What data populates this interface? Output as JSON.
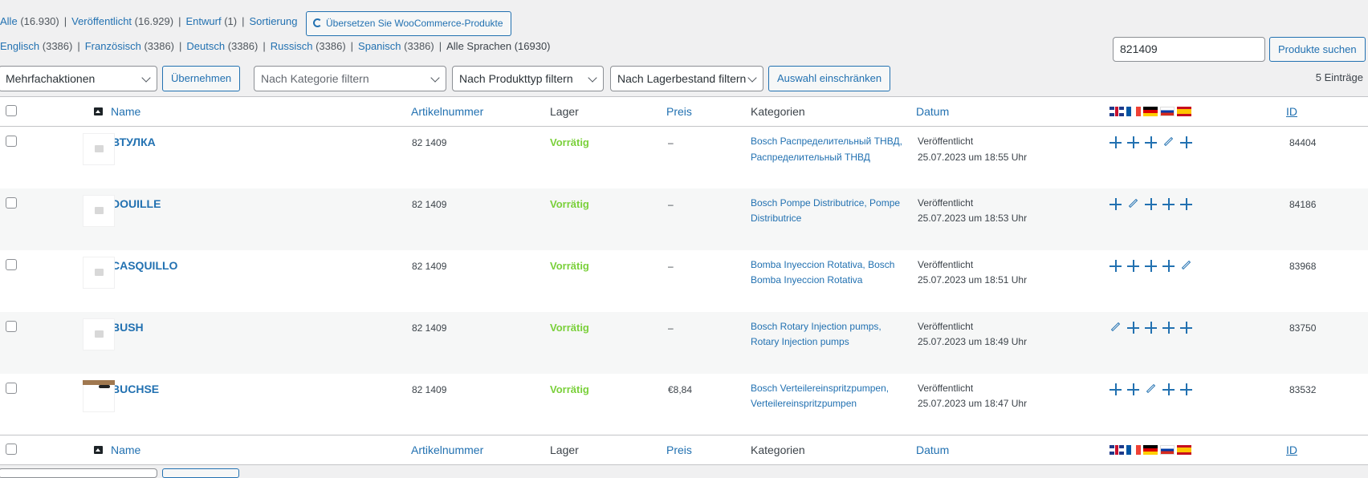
{
  "views": [
    {
      "label": "Alle",
      "count": "(16.930)"
    },
    {
      "label": "Veröffentlicht",
      "count": "(16.929)"
    },
    {
      "label": "Entwurf",
      "count": "(1)"
    },
    {
      "label": "Sortierung",
      "count": ""
    }
  ],
  "wpml_button": "Übersetzen Sie WooCommerce-Produkte",
  "languages": [
    {
      "label": "Englisch",
      "count": "(3386)"
    },
    {
      "label": "Französisch",
      "count": "(3386)"
    },
    {
      "label": "Deutsch",
      "count": "(3386)"
    },
    {
      "label": "Russisch",
      "count": "(3386)"
    },
    {
      "label": "Spanisch",
      "count": "(3386)"
    },
    {
      "label": "Alle Sprachen",
      "count": "(16930)"
    }
  ],
  "search": {
    "value": "821409",
    "button": "Produkte suchen"
  },
  "filters": {
    "bulk_action": "Mehrfachaktionen",
    "apply": "Übernehmen",
    "category_placeholder": "Nach Kategorie filtern",
    "product_type": "Nach Produkttyp filtern",
    "stock": "Nach Lagerbestand filtern",
    "filter_button": "Auswahl einschränken"
  },
  "items_count": "5 Einträge",
  "columns": {
    "name": "Name",
    "sku": "Artikelnummer",
    "stock": "Lager",
    "price": "Preis",
    "categories": "Kategorien",
    "date": "Datum",
    "id": "ID"
  },
  "translation_flags": [
    "gb-flag",
    "fr-flag",
    "de-flag",
    "ru-flag",
    "es-flag"
  ],
  "rows": [
    {
      "name": "ВТУЛКА",
      "sku": "82 1409",
      "stock": "Vorrätig",
      "price": "–",
      "categories": "Bosch Распределительный ТНВД, Распределительный ТНВД",
      "status": "Veröffentlicht",
      "date": "25.07.2023 um 18:55 Uhr",
      "translations": [
        "plus",
        "plus",
        "plus",
        "pencil",
        "plus"
      ],
      "id": "84404",
      "thumb": "placeholder"
    },
    {
      "name": "DOUILLE",
      "sku": "82 1409",
      "stock": "Vorrätig",
      "price": "–",
      "categories": "Bosch Pompe Distributrice, Pompe Distributrice",
      "status": "Veröffentlicht",
      "date": "25.07.2023 um 18:53 Uhr",
      "translations": [
        "plus",
        "pencil",
        "plus",
        "plus",
        "plus"
      ],
      "id": "84186",
      "thumb": "placeholder"
    },
    {
      "name": "CASQUILLO",
      "sku": "82 1409",
      "stock": "Vorrätig",
      "price": "–",
      "categories": "Bomba Inyeccion Rotativa, Bosch Bomba Inyeccion Rotativa",
      "status": "Veröffentlicht",
      "date": "25.07.2023 um 18:51 Uhr",
      "translations": [
        "plus",
        "plus",
        "plus",
        "plus",
        "pencil"
      ],
      "id": "83968",
      "thumb": "placeholder"
    },
    {
      "name": "BUSH",
      "sku": "82 1409",
      "stock": "Vorrätig",
      "price": "–",
      "categories": "Bosch Rotary Injection pumps, Rotary Injection pumps",
      "status": "Veröffentlicht",
      "date": "25.07.2023 um 18:49 Uhr",
      "translations": [
        "pencil",
        "plus",
        "plus",
        "plus",
        "plus"
      ],
      "id": "83750",
      "thumb": "placeholder"
    },
    {
      "name": "BUCHSE",
      "sku": "82 1409",
      "stock": "Vorrätig",
      "price": "€8,84",
      "categories": "Bosch Verteilereinspritzpumpen, Verteilereinspritzpumpen",
      "status": "Veröffentlicht",
      "date": "25.07.2023 um 18:47 Uhr",
      "translations": [
        "plus",
        "plus",
        "pencil",
        "plus",
        "plus"
      ],
      "id": "83532",
      "thumb": "product"
    }
  ]
}
